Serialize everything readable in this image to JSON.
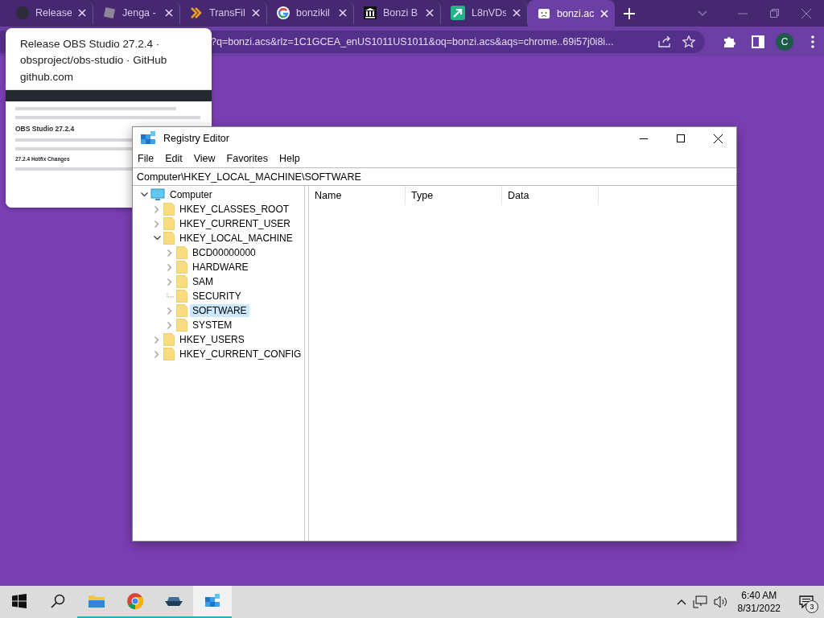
{
  "browser": {
    "tabs": [
      {
        "title": "Release",
        "kind": "dark-circle",
        "selected": false
      },
      {
        "title": "Jenga -",
        "kind": "gray-square",
        "selected": false
      },
      {
        "title": "TransFil",
        "kind": "chevrons",
        "selected": false
      },
      {
        "title": "bonzikil",
        "kind": "ring",
        "selected": false
      },
      {
        "title": "Bonzi B",
        "kind": "building",
        "selected": false
      },
      {
        "title": "L8nVDs",
        "kind": "green-arrow",
        "selected": false
      },
      {
        "title": "bonzi.ac",
        "kind": "sad-page",
        "selected": true
      }
    ],
    "address": "?q=bonzi.acs&rlz=1C1GCEA_enUS1011US1011&oq=bonzi.acs&aqs=chrome..69i57j0i8i...",
    "profile_initial": "C",
    "tab_preview": {
      "title": "Release OBS Studio 27.2.4 · obsproject/obs-studio · GitHub",
      "domain": "github.com",
      "thumbnail": {
        "heading": "OBS Studio 27.2.4",
        "subheading": "27.2.4 Hotfix Changes"
      }
    }
  },
  "registry_editor": {
    "title": "Registry Editor",
    "menu": [
      "File",
      "Edit",
      "View",
      "Favorites",
      "Help"
    ],
    "path": "Computer\\HKEY_LOCAL_MACHINE\\SOFTWARE",
    "columns": [
      "Name",
      "Type",
      "Data"
    ],
    "tree": [
      {
        "label": "Computer",
        "kind": "computer",
        "expandable": true,
        "expanded": true,
        "selected": false,
        "children": [
          {
            "label": "HKEY_CLASSES_ROOT",
            "kind": "folder",
            "expandable": true,
            "expanded": false,
            "selected": false
          },
          {
            "label": "HKEY_CURRENT_USER",
            "kind": "folder",
            "expandable": true,
            "expanded": false,
            "selected": false
          },
          {
            "label": "HKEY_LOCAL_MACHINE",
            "kind": "folder",
            "expandable": true,
            "expanded": true,
            "selected": false,
            "children": [
              {
                "label": "BCD00000000",
                "kind": "folder",
                "expandable": true,
                "expanded": false,
                "selected": false
              },
              {
                "label": "HARDWARE",
                "kind": "folder",
                "expandable": true,
                "expanded": false,
                "selected": false
              },
              {
                "label": "SAM",
                "kind": "folder",
                "expandable": true,
                "expanded": false,
                "selected": false
              },
              {
                "label": "SECURITY",
                "kind": "folder",
                "expandable": false,
                "expanded": false,
                "selected": false
              },
              {
                "label": "SOFTWARE",
                "kind": "folder",
                "expandable": true,
                "expanded": false,
                "selected": true
              },
              {
                "label": "SYSTEM",
                "kind": "folder",
                "expandable": true,
                "expanded": false,
                "selected": false
              }
            ]
          },
          {
            "label": "HKEY_USERS",
            "kind": "folder",
            "expandable": true,
            "expanded": false,
            "selected": false
          },
          {
            "label": "HKEY_CURRENT_CONFIG",
            "kind": "folder",
            "expandable": true,
            "expanded": false,
            "selected": false
          }
        ]
      }
    ]
  },
  "taskbar": {
    "apps": [
      {
        "kind": "explorer",
        "running": true,
        "active": false
      },
      {
        "kind": "chrome",
        "running": true,
        "active": false
      },
      {
        "kind": "boat",
        "running": true,
        "active": false
      },
      {
        "kind": "regedit",
        "running": true,
        "active": true
      }
    ],
    "time": "6:40 AM",
    "date": "8/31/2022",
    "notifications": "3"
  }
}
